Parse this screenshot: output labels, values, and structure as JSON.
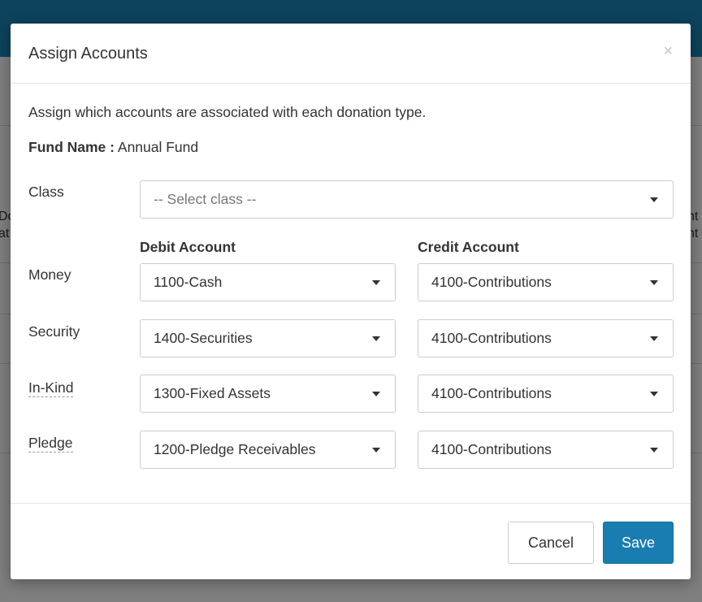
{
  "background": {
    "left_fragments": [
      "Do",
      "at"
    ],
    "right_fragments": [
      "nt",
      "nt"
    ]
  },
  "modal": {
    "title": "Assign Accounts",
    "close_symbol": "×",
    "intro": "Assign which accounts are associated with each donation type.",
    "fund_label": "Fund Name :",
    "fund_value": "Annual Fund",
    "class_label": "Class",
    "class_placeholder": "-- Select class --",
    "debit_header": "Debit Account",
    "credit_header": "Credit Account",
    "rows": [
      {
        "label": "Money",
        "debit": "1100-Cash",
        "credit": "4100-Contributions"
      },
      {
        "label": "Security",
        "debit": "1400-Securities",
        "credit": "4100-Contributions"
      },
      {
        "label": "In-Kind",
        "debit": "1300-Fixed Assets",
        "credit": "4100-Contributions"
      },
      {
        "label": "Pledge",
        "debit": "1200-Pledge Receivables",
        "credit": "4100-Contributions"
      }
    ],
    "cancel_label": "Cancel",
    "save_label": "Save"
  },
  "colors": {
    "brand_topbar": "#1a87b9",
    "save_button": "#1a7db1"
  }
}
